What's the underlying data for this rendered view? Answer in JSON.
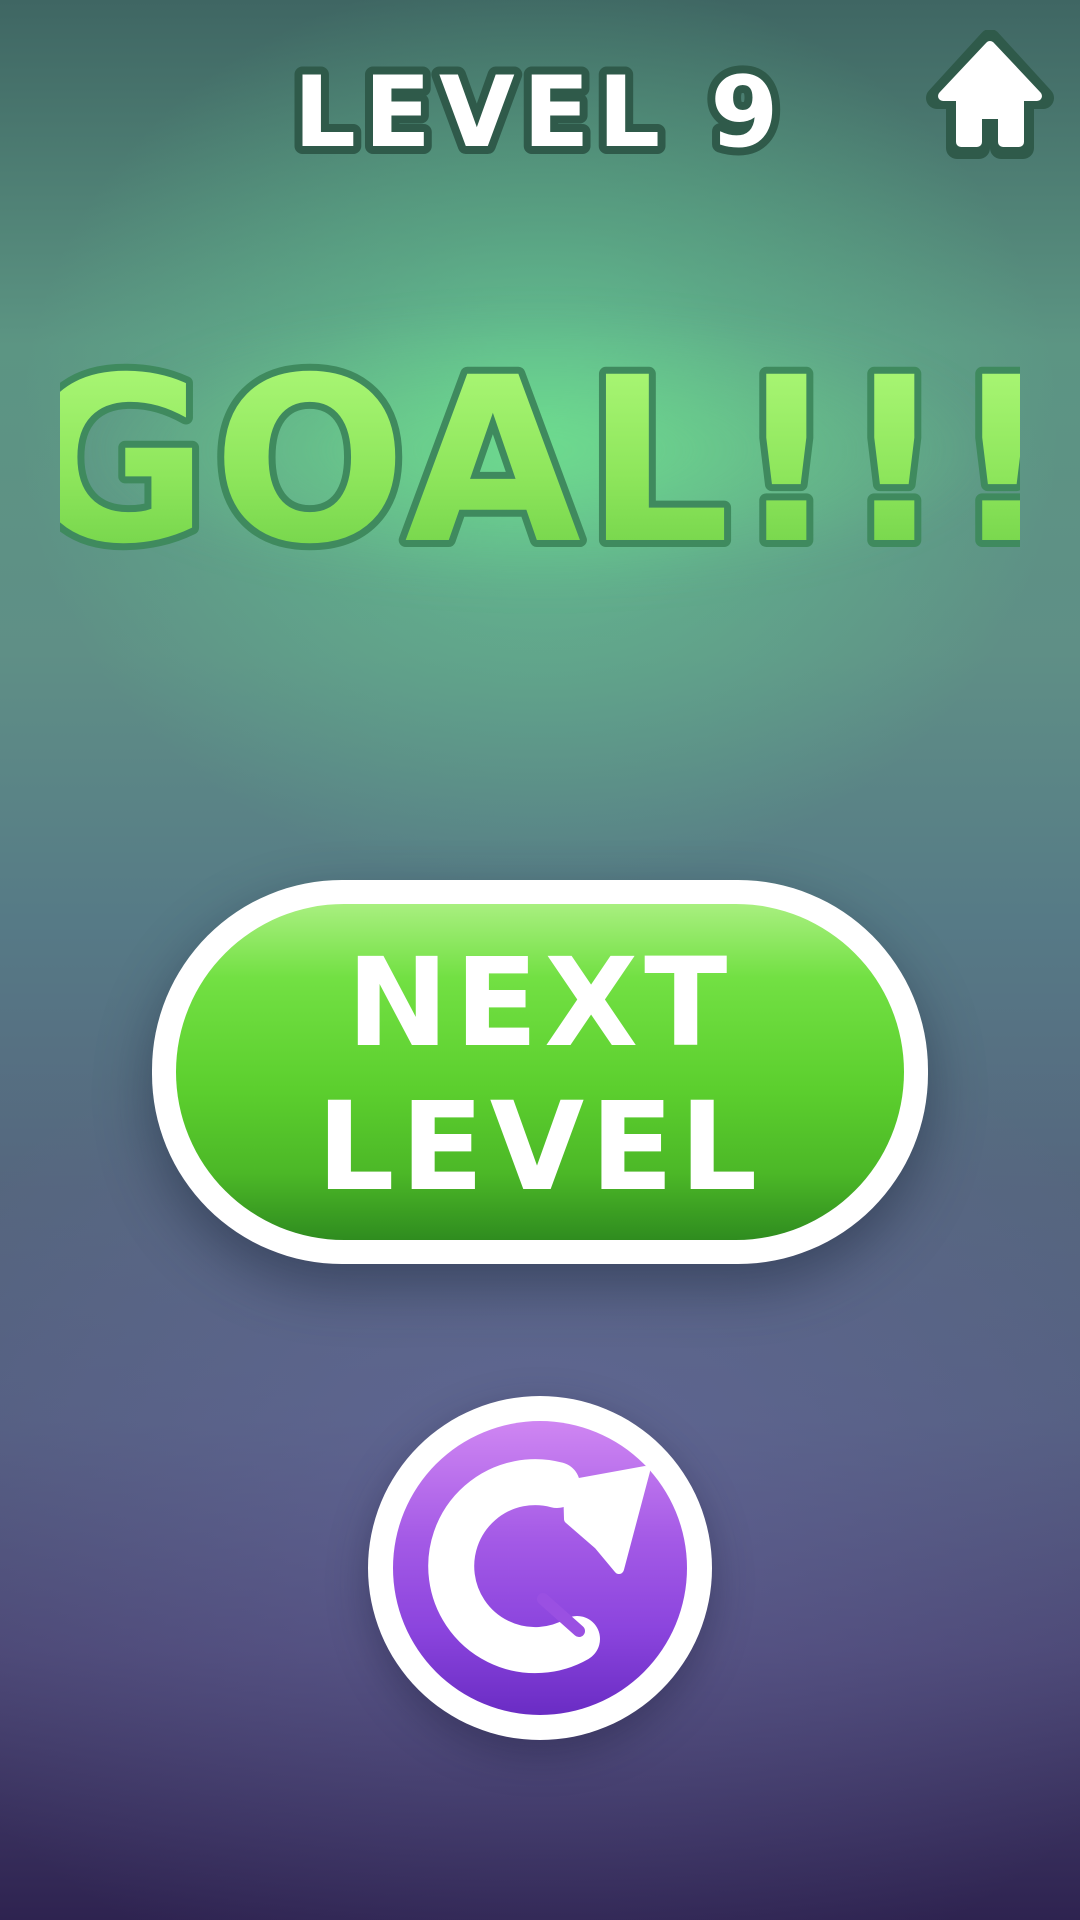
{
  "header": {
    "level_label": "LEVEL 9",
    "home_icon": "home-icon"
  },
  "result": {
    "title": "GOAL!!!"
  },
  "actions": {
    "next_level_line1": "NEXT",
    "next_level_line2": "LEVEL",
    "restart_icon": "restart-icon"
  },
  "colors": {
    "goal_green": "#8ee65c",
    "next_button_green": "#5ccf2e",
    "restart_purple": "#9a50e2",
    "text_outline": "#3f6f5c"
  }
}
